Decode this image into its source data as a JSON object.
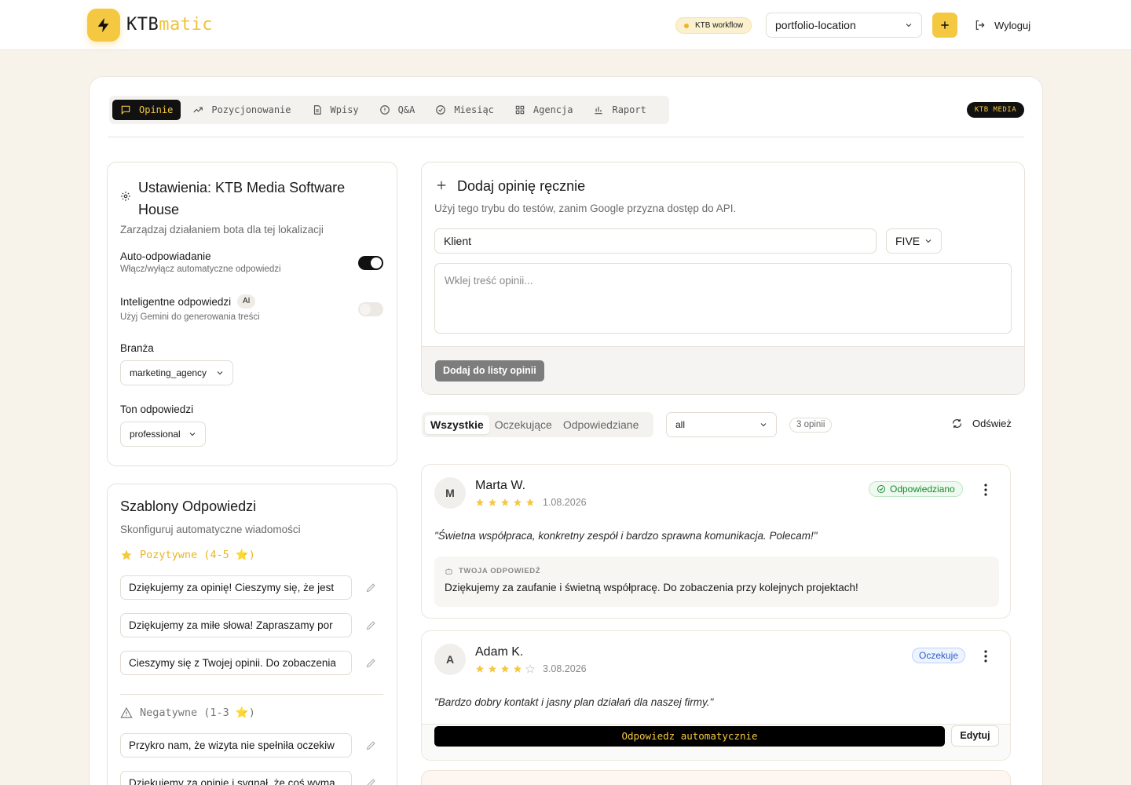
{
  "brand": {
    "name_part1": "KTB",
    "name_part2": "matic"
  },
  "header": {
    "workflow_badge": "KTB workflow",
    "location": "portfolio-location",
    "logout_label": "Wyloguj"
  },
  "tabs": [
    {
      "label": "Opinie",
      "icon": "message-square-icon"
    },
    {
      "label": "Pozycjonowanie",
      "icon": "trending-up-icon"
    },
    {
      "label": "Wpisy",
      "icon": "file-text-icon"
    },
    {
      "label": "Q&A",
      "icon": "info-circle-icon"
    },
    {
      "label": "Miesiąc",
      "icon": "check-circle-icon"
    },
    {
      "label": "Agencja",
      "icon": "grid-icon"
    },
    {
      "label": "Raport",
      "icon": "bar-chart-icon"
    }
  ],
  "company_badge": "KTB MEDIA",
  "settings": {
    "title": "Ustawienia: KTB Media Software House",
    "subtitle": "Zarządzaj działaniem bota dla tej lokalizacji",
    "auto_reply": {
      "label": "Auto-odpowiadanie",
      "hint": "Włącz/wyłącz automatyczne odpowiedzi",
      "enabled": true
    },
    "smart_reply": {
      "label": "Inteligentne odpowiedzi",
      "badge": "AI",
      "hint": "Użyj Gemini do generowania treści",
      "enabled": false
    },
    "industry": {
      "label": "Branża",
      "value": "marketing_agency"
    },
    "tone": {
      "label": "Ton odpowiedzi",
      "value": "professional"
    }
  },
  "templates": {
    "title": "Szablony Odpowiedzi",
    "subtitle": "Skonfiguruj automatyczne wiadomości",
    "positive_label": "Pozytywne (4-5 ⭐)",
    "positive": [
      "Dziękujemy za opinię! Cieszymy się, że jest",
      "Dziękujemy za miłe słowa! Zapraszamy por",
      "Cieszymy się z Twojej opinii. Do zobaczenia"
    ],
    "negative_label": "Negatywne (1-3 ⭐)",
    "negative": [
      "Przykro nam, że wizyta nie spełniła oczekiw",
      "Dziękujemy za opinię i sygnał, że coś wyma"
    ]
  },
  "add_review": {
    "title": "Dodaj opinię ręcznie",
    "subtitle": "Użyj tego trybu do testów, zanim Google przyzna dostęp do API.",
    "client_value": "Klient",
    "rating_value": "FIVE",
    "text_placeholder": "Wklej treść opinii...",
    "submit_label": "Dodaj do listy opinii"
  },
  "filters": {
    "tabs": [
      "Wszystkie",
      "Oczekujące",
      "Odpowiedziane"
    ],
    "active_tab": "Wszystkie",
    "status_value": "all",
    "count": "3 opinii",
    "refresh_label": "Odśwież"
  },
  "reviews": [
    {
      "initial": "M",
      "name": "Marta W.",
      "rating": 5,
      "date": "1.08.2026",
      "status": "Odpowiedziano",
      "text": "\"Świetna współpraca, konkretny zespół i bardzo sprawna komunikacja. Polecam!\"",
      "reply_label": "TWOJA ODPOWIEDŹ",
      "reply": "Dziękujemy za zaufanie i świetną współpracę. Do zobaczenia przy kolejnych projektach!"
    },
    {
      "initial": "A",
      "name": "Adam K.",
      "rating": 4,
      "date": "3.08.2026",
      "status": "Oczekuje",
      "text": "\"Bardzo dobry kontakt i jasny plan działań dla naszej firmy.\"",
      "auto_reply_label": "Odpowiedz automatycznie",
      "edit_label": "Edytuj"
    }
  ],
  "colors": {
    "accent": "#f5c842",
    "dark": "#111111",
    "success": "#1a8a2f",
    "info": "#2a5dc7"
  }
}
